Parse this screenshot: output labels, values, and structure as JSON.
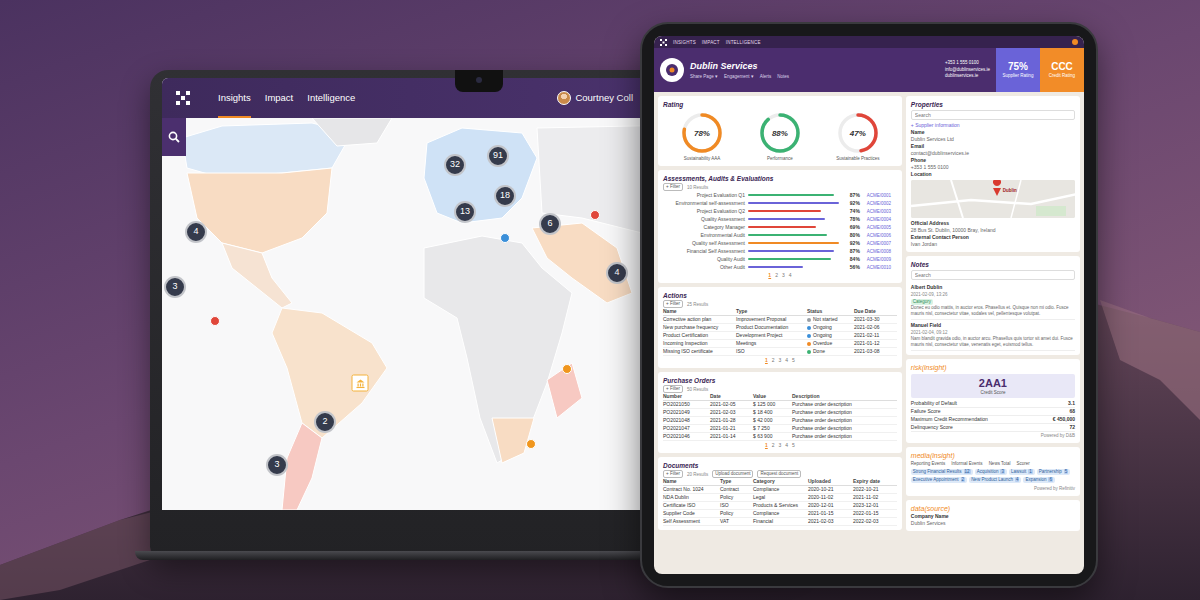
{
  "laptop": {
    "nav": [
      {
        "label": "Insights",
        "selected": true
      },
      {
        "label": "Impact",
        "selected": false
      },
      {
        "label": "Intelligence",
        "selected": false
      }
    ],
    "user": "Courtney Coll",
    "map": {
      "regions": [
        {
          "color": "#dbe8f6"
        },
        {
          "color": "#f8dcc3"
        },
        {
          "color": "#f6e3d3"
        },
        {
          "color": "#e6e6e8"
        },
        {
          "color": "#f8e2cc"
        },
        {
          "color": "#f7c9c2"
        },
        {
          "color": "#cfe2f6"
        },
        {
          "color": "#e8e8ea"
        },
        {
          "color": "#f8dcc3"
        },
        {
          "color": "#ececee"
        },
        {
          "color": "#f7c9c2"
        },
        {
          "color": "#f8dcc3"
        }
      ],
      "markers": [
        {
          "kind": "cluster",
          "count": "32"
        },
        {
          "kind": "cluster",
          "count": "91"
        },
        {
          "kind": "cluster",
          "count": "18"
        },
        {
          "kind": "cluster",
          "count": "13"
        },
        {
          "kind": "cluster",
          "count": "6"
        },
        {
          "kind": "cluster",
          "count": "4"
        },
        {
          "kind": "cluster",
          "count": "4"
        },
        {
          "kind": "cluster",
          "count": "3"
        },
        {
          "kind": "cluster",
          "count": "2"
        },
        {
          "kind": "cluster",
          "count": "3"
        },
        {
          "kind": "dot",
          "color": "#e0463a"
        },
        {
          "kind": "dot",
          "color": "#3b8fd9"
        },
        {
          "kind": "dot",
          "color": "#e0463a"
        },
        {
          "kind": "dot",
          "color": "#f0961e"
        },
        {
          "kind": "dot",
          "color": "#f0961e"
        },
        {
          "kind": "pin",
          "color": "#f4b23a"
        }
      ]
    }
  },
  "tablet": {
    "topnav": [
      "INSIGHTS",
      "IMPACT",
      "INTELLIGENCE"
    ],
    "title": "Dublin Services",
    "links": [
      "Share Page ▾",
      "Engagement ▾",
      "Alerts",
      "Notes"
    ],
    "contacts": [
      "+353 1 555 0100",
      "info@dublinservices.ie",
      "dublinservices.ie"
    ],
    "badges": [
      {
        "value": "75%",
        "label": "Supplier Rating",
        "color": "#6a63d8"
      },
      {
        "value": "CCC",
        "label": "Credit Rating",
        "color": "#f28c28"
      }
    ],
    "rating": {
      "title": "Rating",
      "gauges": [
        {
          "value": "78%",
          "label": "Sustainability AAA",
          "level": 0.78,
          "color": "#f08a24"
        },
        {
          "value": "88%",
          "label": "Performance",
          "level": 0.88,
          "color": "#3bb273"
        },
        {
          "value": "47%",
          "label": "Sustainable Practices",
          "level": 0.47,
          "color": "#e0463a"
        }
      ]
    },
    "assessments": {
      "title": "Assessments, Audits & Evaluations",
      "filter": {
        "button": "+ Filter",
        "results": "10 Results"
      },
      "rows": [
        {
          "name": "Project Evaluation Q1",
          "pct": "87%",
          "ref": "ACME/0001",
          "level": 0.87,
          "color": "#3bb273"
        },
        {
          "name": "Environmental self-assessment",
          "pct": "92%",
          "ref": "ACME/0002",
          "level": 0.92,
          "color": "#6a63d8"
        },
        {
          "name": "Project Evaluation Q2",
          "pct": "74%",
          "ref": "ACME/0003",
          "level": 0.74,
          "color": "#e0463a"
        },
        {
          "name": "Quality Assessment",
          "pct": "78%",
          "ref": "ACME/0004",
          "level": 0.78,
          "color": "#6a63d8"
        },
        {
          "name": "Category Manager",
          "pct": "69%",
          "ref": "ACME/0005",
          "level": 0.69,
          "color": "#e0463a"
        },
        {
          "name": "Environmental Audit",
          "pct": "80%",
          "ref": "ACME/0006",
          "level": 0.8,
          "color": "#3bb273"
        },
        {
          "name": "Quality self Assessment",
          "pct": "92%",
          "ref": "ACME/0007",
          "level": 0.92,
          "color": "#f08a24"
        },
        {
          "name": "Financial Self Assessment",
          "pct": "87%",
          "ref": "ACME/0008",
          "level": 0.87,
          "color": "#6a63d8"
        },
        {
          "name": "Quality Audit",
          "pct": "84%",
          "ref": "ACME/0009",
          "level": 0.84,
          "color": "#3bb273"
        },
        {
          "name": "Other Audit",
          "pct": "56%",
          "ref": "ACME/0010",
          "level": 0.56,
          "color": "#6a63d8"
        }
      ],
      "pages": [
        {
          "label": "1",
          "selected": true
        },
        {
          "label": "2",
          "selected": false
        },
        {
          "label": "3",
          "selected": false
        },
        {
          "label": "4",
          "selected": false
        }
      ]
    },
    "actions": {
      "title": "Actions",
      "filter": {
        "button": "+ Filter",
        "results": "25 Results"
      },
      "columns": [
        "Name",
        "Type",
        "Status",
        "Due Date"
      ],
      "rows": [
        {
          "cells": [
            "Corrective action plan",
            "Improvement Proposal",
            "Not started",
            "2021-03-30"
          ],
          "color": "#9aa0a6"
        },
        {
          "cells": [
            "New purchase frequency",
            "Product Documentation",
            "Ongoing",
            "2021-02-06"
          ],
          "color": "#3b8fd9"
        },
        {
          "cells": [
            "Product Certification",
            "Development Project",
            "Ongoing",
            "2021-02-11"
          ],
          "color": "#3b8fd9"
        },
        {
          "cells": [
            "Incoming Inspection",
            "Meetings",
            "Overdue",
            "2021-01-12"
          ],
          "color": "#f08a24"
        },
        {
          "cells": [
            "Missing ISO certificate",
            "ISO",
            "Done",
            "2021-03-08"
          ],
          "color": "#3bb273"
        }
      ],
      "pages": [
        {
          "label": "1",
          "selected": true
        },
        {
          "label": "2",
          "selected": false
        },
        {
          "label": "3",
          "selected": false
        },
        {
          "label": "4",
          "selected": false
        },
        {
          "label": "5",
          "selected": false
        }
      ]
    },
    "purchase_orders": {
      "title": "Purchase Orders",
      "filter": {
        "button": "+ Filter",
        "results": "50 Results"
      },
      "columns": [
        "Number",
        "Date",
        "Value",
        "Description"
      ],
      "rows": [
        [
          "PO2021050",
          "2021-02-05",
          "$ 125 000",
          "Purchase order description"
        ],
        [
          "PO2021049",
          "2021-02-03",
          "$ 18 400",
          "Purchase order description"
        ],
        [
          "PO2021048",
          "2021-01-28",
          "$ 42 000",
          "Purchase order description"
        ],
        [
          "PO2021047",
          "2021-01-21",
          "$ 7 250",
          "Purchase order description"
        ],
        [
          "PO2021046",
          "2021-01-14",
          "$ 63 900",
          "Purchase order description"
        ]
      ],
      "pages": [
        {
          "label": "1",
          "selected": true
        },
        {
          "label": "2",
          "selected": false
        },
        {
          "label": "3",
          "selected": false
        },
        {
          "label": "4",
          "selected": false
        },
        {
          "label": "5",
          "selected": false
        }
      ]
    },
    "documents": {
      "title": "Documents",
      "filter": {
        "button": "+ Filter",
        "results": "20 Results"
      },
      "buttons": [
        "Upload document",
        "Request document"
      ],
      "columns": [
        "Name",
        "Type",
        "Category",
        "Uploaded",
        "Expiry date"
      ],
      "rows": [
        [
          "Contract No. 1024",
          "Contract",
          "Compliance",
          "2020-10-21",
          "2022-10-21"
        ],
        [
          "NDA Dublin",
          "Policy",
          "Legal",
          "2020-11-02",
          "2021-11-02"
        ],
        [
          "Certificate ISO",
          "ISO",
          "Products & Services",
          "2020-12-01",
          "2023-12-01"
        ],
        [
          "Supplier Code",
          "Policy",
          "Compliance",
          "2021-01-15",
          "2022-01-15"
        ],
        [
          "Self Assessment",
          "VAT",
          "Financial",
          "2021-02-03",
          "2022-02-03"
        ]
      ]
    },
    "properties": {
      "title": "Properties",
      "search": "Search",
      "section": "+ Supplier information",
      "fields": [
        {
          "label": "Name",
          "value": "Dublin Services Ltd"
        },
        {
          "label": "Email",
          "value": "contact@dublinservices.ie"
        },
        {
          "label": "Phone",
          "value": "+353 1 555 0100"
        }
      ],
      "location_label": "Location",
      "map_label": "Dublin",
      "address_label": "Official Address",
      "address": "28 Bus St. Dublin, 10000 Bray, Ireland",
      "contact_label": "External Contact Person",
      "contact": "Ivan Jordan"
    },
    "notes": {
      "title": "Notes",
      "search": "Search",
      "items": [
        {
          "author": "Albert Dublin",
          "date": "2021-02-09, 13:26",
          "tag": "Category",
          "text": "Donec eu odio mattis, in auctor eros. Phasellus et. Quisque non mi odio. Fusce mauris nisl, consectetur vitae, sodales vel, pellentesque volutpat."
        },
        {
          "author": "Manuel Field",
          "date": "2021-02-04, 09:12",
          "text": "Nam blandit gravida odio, in auctor arcu. Phasellus quis tortor sit amet dui. Fusce mauris nisl, consectetur vitae, venenatis eget, euismod tellus."
        }
      ]
    },
    "credit": {
      "brand": "risk(insight)",
      "score": "2AA1",
      "score_label": "Credit Score",
      "rows": [
        {
          "label": "Probability of Default",
          "value": "3.1"
        },
        {
          "label": "Failure Score",
          "value": "68"
        },
        {
          "label": "Maximum Credit Recommendation",
          "value": "€ 450,000"
        },
        {
          "label": "Delinquency Score",
          "value": "72"
        }
      ],
      "powered": "Powered by D&B"
    },
    "media": {
      "brand": "media(insight)",
      "labels": [
        "Reporting Events",
        "Informal Events",
        "News Total",
        "Scorer"
      ],
      "tags": [
        {
          "label": "Strong Financial Results",
          "count": "12"
        },
        {
          "label": "Acquisition",
          "count": "3"
        },
        {
          "label": "Lawsuit",
          "count": "1"
        },
        {
          "label": "Partnership",
          "count": "5"
        },
        {
          "label": "Executive Appointment",
          "count": "2"
        },
        {
          "label": "New Product Launch",
          "count": "4"
        },
        {
          "label": "Expansion",
          "count": "6"
        }
      ],
      "powered": "Powered by Refinitiv"
    },
    "company": {
      "brand": "data(source)",
      "label": "Company Name",
      "value": "Dublin Services"
    }
  }
}
